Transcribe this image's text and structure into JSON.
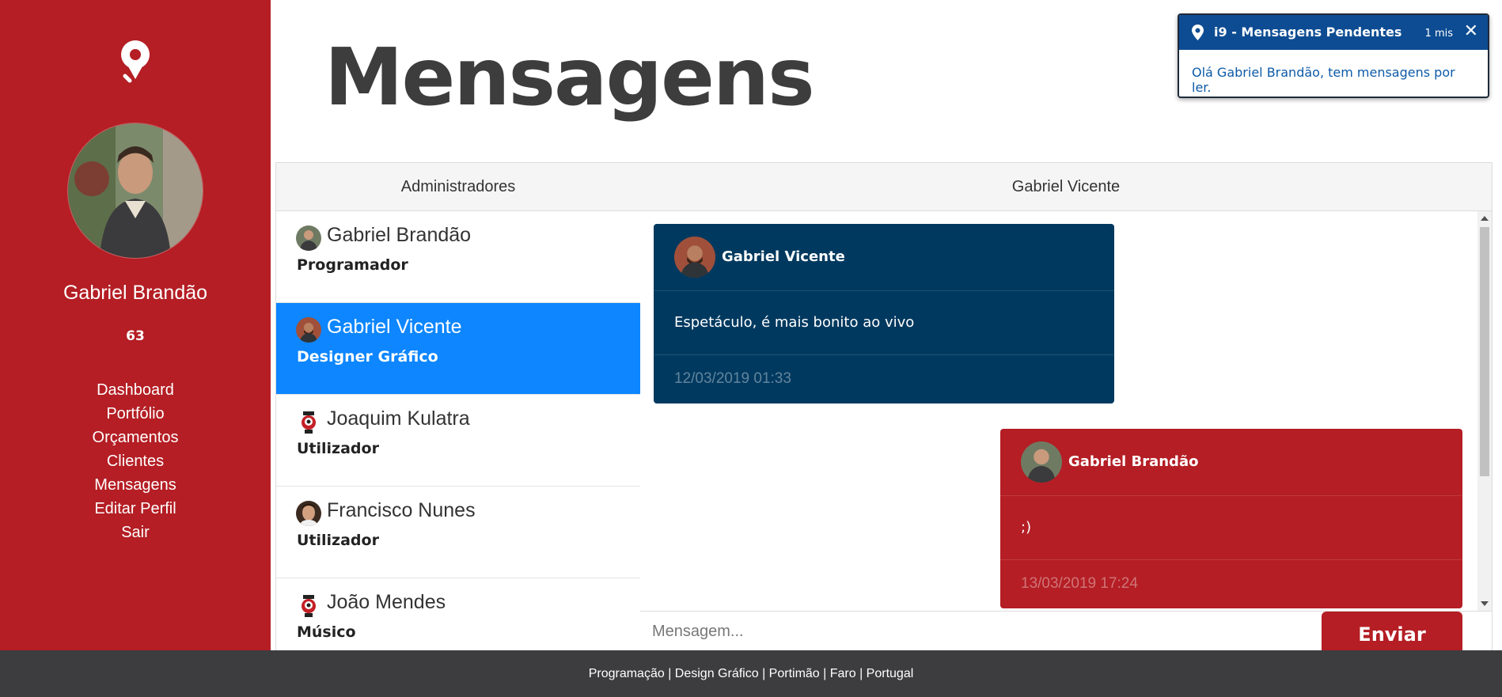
{
  "sidebar": {
    "user_name": "Gabriel Brandão",
    "count": "63",
    "nav": [
      "Dashboard",
      "Portfólio",
      "Orçamentos",
      "Clientes",
      "Mensagens",
      "Editar Perfil",
      "Sair"
    ]
  },
  "page": {
    "title": "Mensagens"
  },
  "toast": {
    "title": "i9 - Mensagens Pendentes",
    "time": "1 mis",
    "body": "Olá Gabriel Brandão, tem mensagens por ler."
  },
  "contacts": {
    "header": "Administradores",
    "items": [
      {
        "name": "Gabriel Brandão",
        "role": "Programador"
      },
      {
        "name": "Gabriel Vicente",
        "role": "Designer Gráfico"
      },
      {
        "name": "Joaquim Kulatra",
        "role": "Utilizador"
      },
      {
        "name": "Francisco Nunes",
        "role": "Utilizador"
      },
      {
        "name": "João Mendes",
        "role": "Músico"
      }
    ]
  },
  "chat": {
    "header": "Gabriel Vicente",
    "messages": [
      {
        "author": "Gabriel Vicente",
        "text": "Espetáculo, é mais bonito ao vivo",
        "date": "12/03/2019 01:33"
      },
      {
        "author": "Gabriel Brandão",
        "text": ";)",
        "date": "13/03/2019 17:24"
      }
    ],
    "input_placeholder": "Mensagem...",
    "send_label": "Enviar"
  },
  "footer": {
    "text": "Programação | Design Gráfico | Portimão | Faro | Portugal"
  },
  "colors": {
    "brand_red": "#b41e24",
    "selected_blue": "#0d86ff",
    "navy": "#00395f",
    "toast_blue": "#0d4c92"
  }
}
